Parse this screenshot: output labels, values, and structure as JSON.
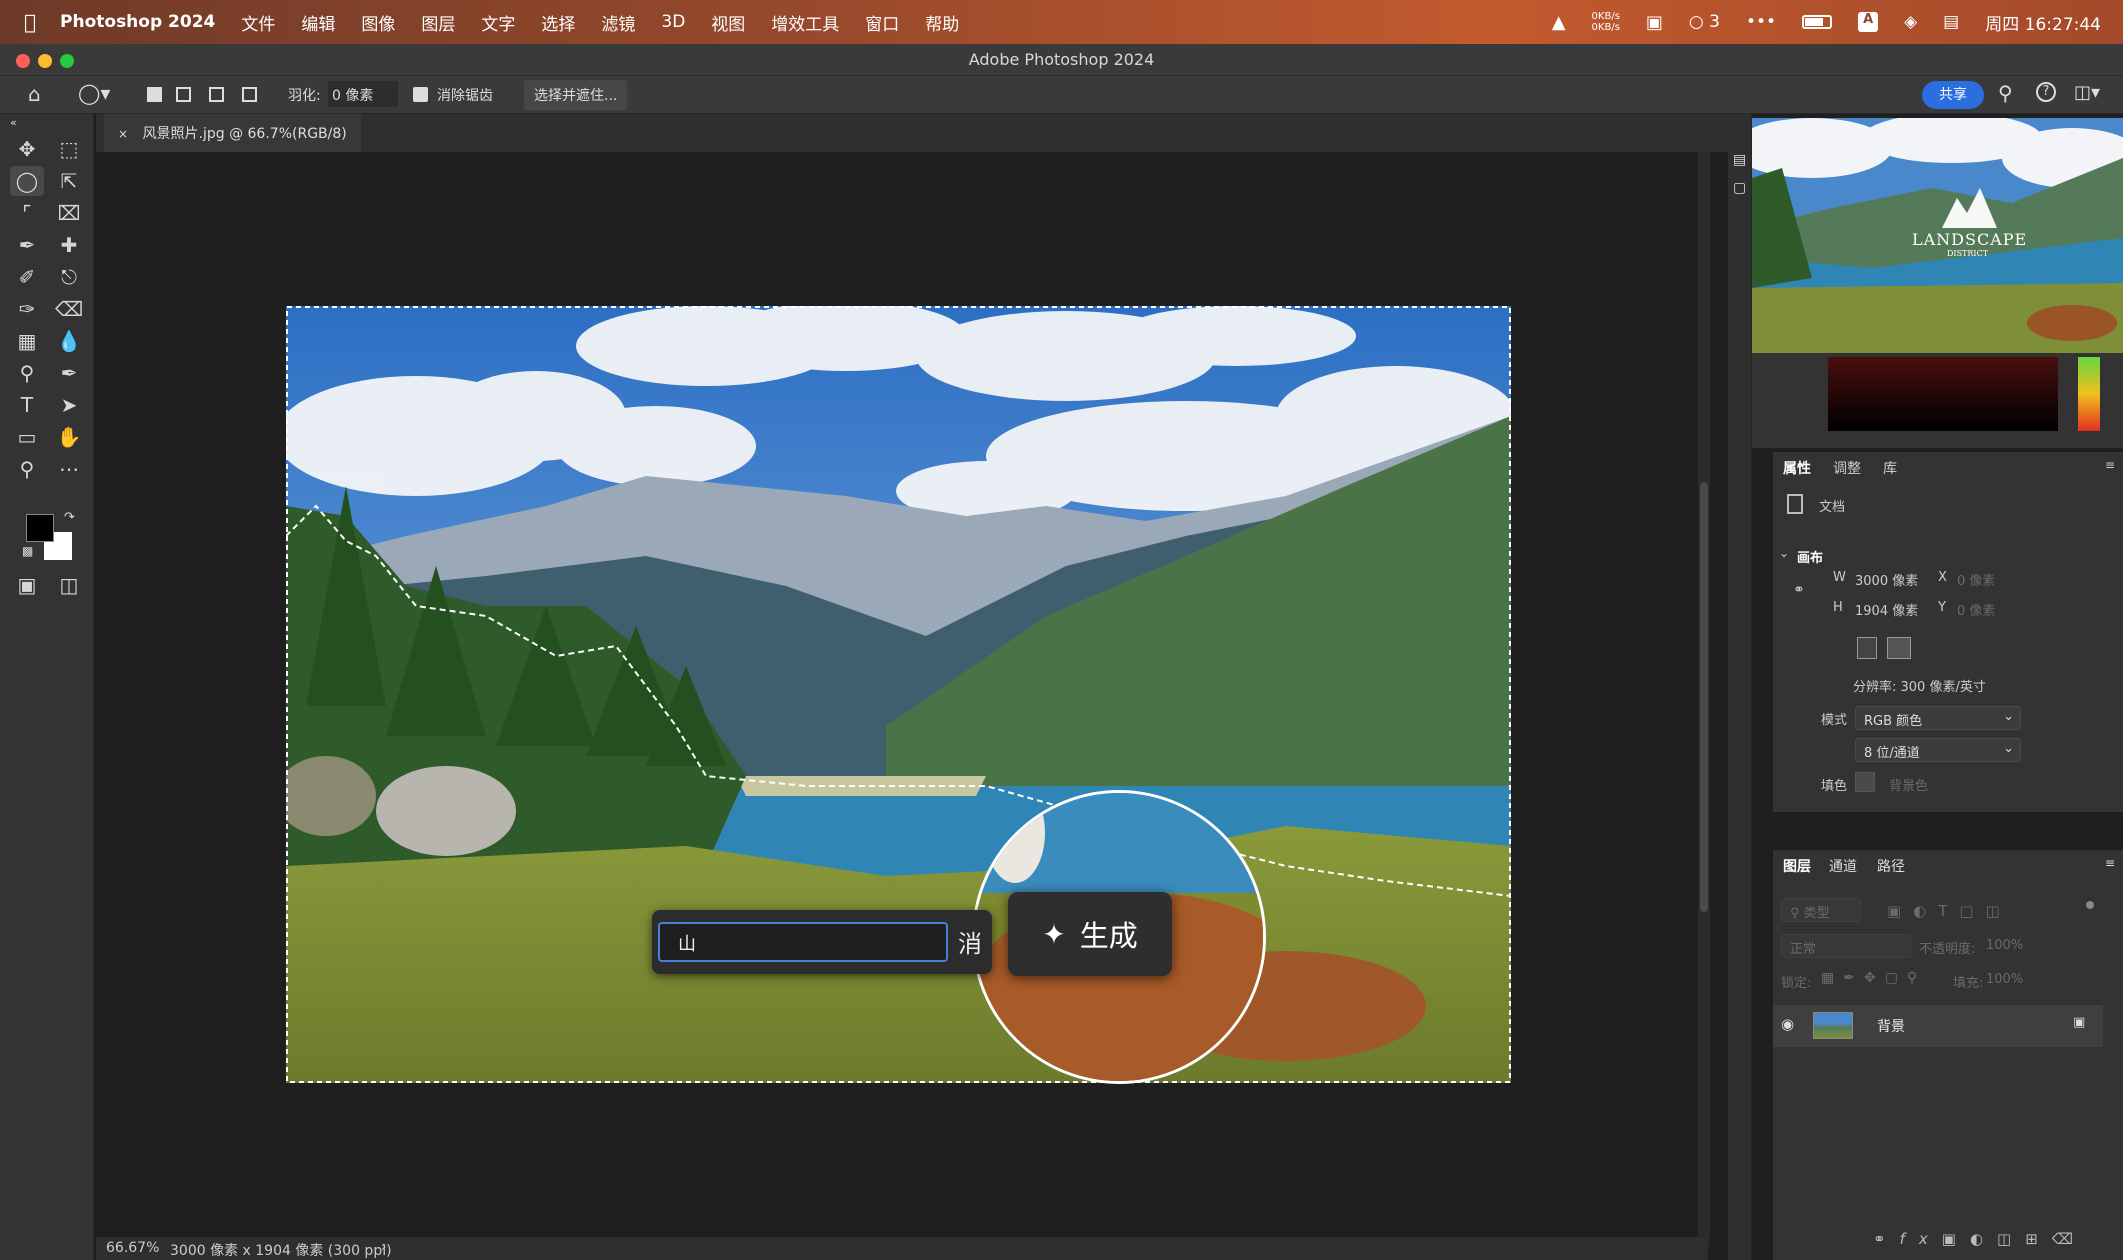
{
  "menubar": {
    "app_name": "Photoshop 2024",
    "items": [
      "文件",
      "编辑",
      "图像",
      "图层",
      "文字",
      "选择",
      "滤镜",
      "3D",
      "视图",
      "增效工具",
      "窗口",
      "帮助"
    ],
    "net_up": "0KB/s",
    "net_down": "0KB/s",
    "chat_count": "3",
    "clock": "周四 16:27:44"
  },
  "window": {
    "title": "Adobe Photoshop 2024"
  },
  "options": {
    "feather_label": "羽化:",
    "feather_value": "0 像素",
    "antialias_label": "消除锯齿",
    "select_mask_label": "选择并遮住...",
    "share_label": "共享"
  },
  "document": {
    "tab_title": "风景照片.jpg @ 66.7%(RGB/8)",
    "zoom": "66.67%",
    "doc_info": "3000 像素 x 1904 像素 (300 ppi)"
  },
  "generative": {
    "prompt_value": "山",
    "cancel_label": "消",
    "generate_label": "生成"
  },
  "navigator": {
    "logo_text": "LANDSCAPE",
    "logo_sub": "DISTRICT"
  },
  "properties": {
    "tabs": [
      "属性",
      "调整",
      "库"
    ],
    "doc_label": "文档",
    "section": "画布",
    "w_label": "W",
    "w_value": "3000 像素",
    "h_label": "H",
    "h_value": "1904 像素",
    "x_label": "X",
    "x_value": "0 像素",
    "y_label": "Y",
    "y_value": "0 像素",
    "resolution": "分辨率: 300 像素/英寸",
    "mode_label": "模式",
    "mode_value": "RGB 颜色",
    "depth_value": "8 位/通道",
    "fill_label": "填色",
    "fill_value": "背景色"
  },
  "layers": {
    "tabs": [
      "图层",
      "通道",
      "路径"
    ],
    "filter_label": "类型",
    "blend_mode": "正常",
    "opacity_label": "不透明度:",
    "opacity_value": "100%",
    "lock_label": "锁定:",
    "fill_label": "填充:",
    "fill_value": "100%",
    "layer_name": "背景"
  },
  "colors": {
    "accent": "#2a6ee0",
    "sky": "#3f86d6",
    "lake": "#2f86b4"
  }
}
